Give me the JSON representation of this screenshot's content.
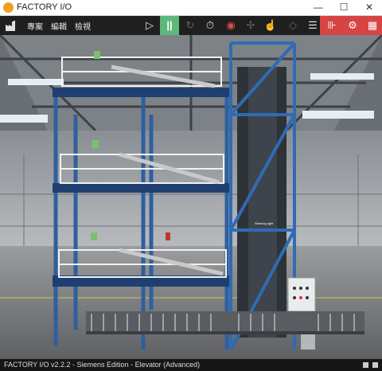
{
  "window": {
    "title": "FACTORY I/O",
    "minimize": "—",
    "maximize": "☐",
    "close": "✕"
  },
  "menu": {
    "items": [
      "專案",
      "編輯",
      "檢視"
    ]
  },
  "toolbar": {
    "play": "▷",
    "pause": "||",
    "reset": "↻",
    "timer": "⏱",
    "record": "◉",
    "fan": "✢",
    "hand": "☝",
    "diamond": "◇",
    "list": "☰",
    "io": "⊪",
    "drivers": "⚙",
    "grid": "▦",
    "pause_color": "#5fb87a",
    "accent_red": "#d64444"
  },
  "scene": {
    "sign_label": "Warning light"
  },
  "status": {
    "text": "FACTORY I/O v2.2.2 - Siemens Edition - Elevator (Advanced)"
  }
}
